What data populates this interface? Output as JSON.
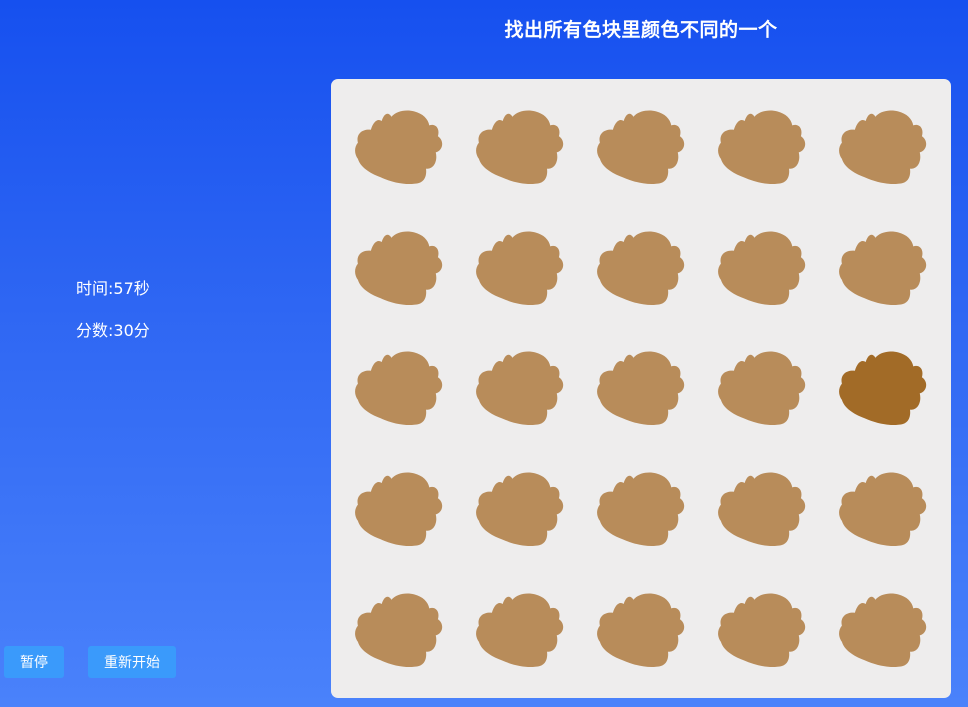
{
  "game": {
    "title": "找出所有色块里颜色不同的一个"
  },
  "status": {
    "time_label": "时间: ",
    "time_value": "57",
    "time_unit": "秒",
    "score_label": "分数: ",
    "score_value": "30",
    "score_unit": "分"
  },
  "controls": {
    "pause_label": "暂停",
    "restart_label": "重新开始"
  },
  "board": {
    "rows": 5,
    "cols": 5,
    "base_color": "#b88c5a",
    "odd_color": "#a26b27",
    "odd_row": 2,
    "odd_col": 4,
    "shape_icon": "blob-icon",
    "background_color": "#eeeded"
  }
}
